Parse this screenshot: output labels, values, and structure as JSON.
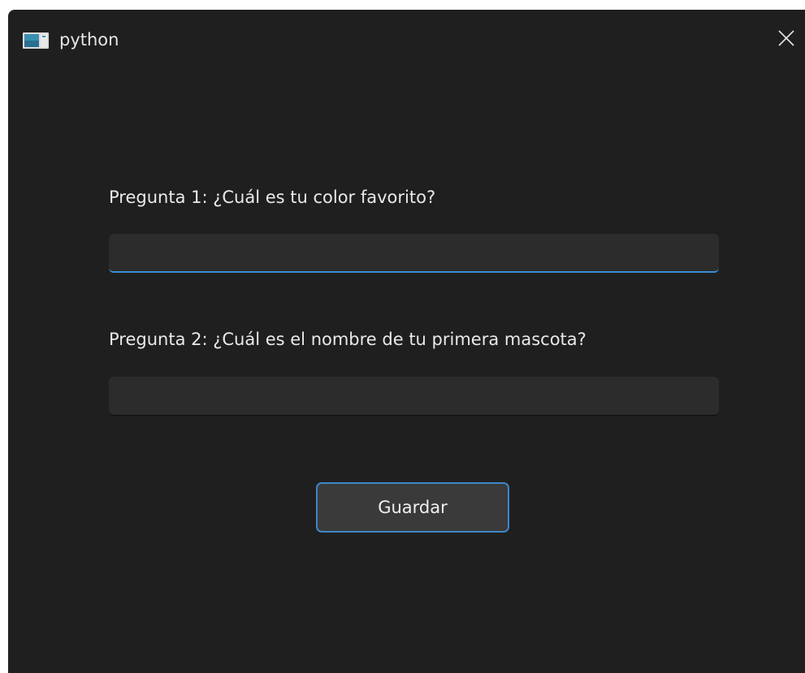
{
  "window": {
    "title": "python"
  },
  "form": {
    "question1": {
      "label": "Pregunta 1: ¿Cuál es tu color favorito?",
      "value": ""
    },
    "question2": {
      "label": "Pregunta 2: ¿Cuál es el nombre de tu primera mascota?",
      "value": ""
    },
    "save_label": "Guardar"
  },
  "icons": {
    "app": "app-window-icon",
    "close": "close-icon"
  },
  "colors": {
    "window_bg": "#1f1f1f",
    "field_bg": "#2c2c2c",
    "accent": "#3b8fd6",
    "text": "#e9e9e9"
  }
}
